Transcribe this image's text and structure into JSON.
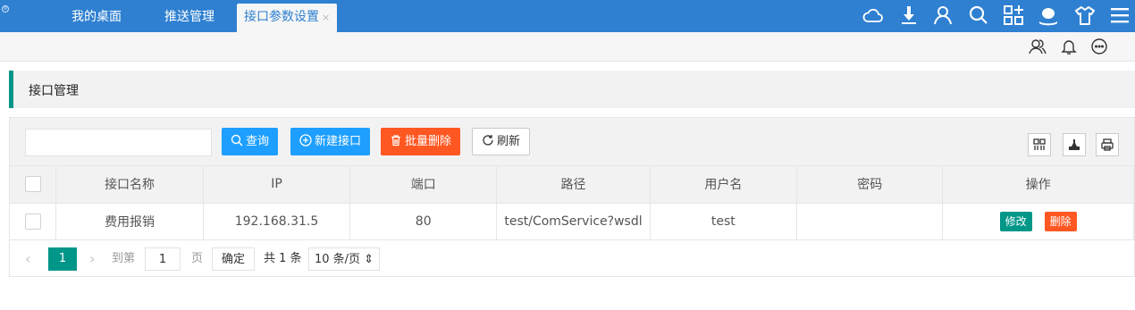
{
  "topbar": {
    "tabs": [
      "我的桌面",
      "推送管理",
      "接口参数设置"
    ],
    "tab_close": "×",
    "icons": [
      "cloud-icon",
      "download-icon",
      "user-icon",
      "search-icon",
      "apps-icon",
      "skin-icon",
      "shirt-icon",
      "menu-icon"
    ],
    "color": "#2f80d1"
  },
  "subbar": {
    "icons": [
      "users-icon",
      "bell-icon",
      "chat-icon"
    ]
  },
  "page": {
    "title": "接口管理"
  },
  "toolbar": {
    "search_placeholder": "",
    "query_label": "查询",
    "add_label": "新建接口",
    "batch_delete_label": "批量删除",
    "refresh_label": "刷新",
    "right_tools": [
      "columns-icon",
      "export-icon",
      "print-icon"
    ]
  },
  "table": {
    "columns": [
      "接口名称",
      "IP",
      "端口",
      "路径",
      "用户名",
      "密码",
      "操作"
    ],
    "rows": [
      {
        "name": "费用报销",
        "ip": "192.168.31.5",
        "port": "80",
        "path": "test/ComService?wsdl",
        "username": "test",
        "password": "",
        "edit": "修改",
        "delete": "删除"
      }
    ]
  },
  "pager": {
    "current": "1",
    "goto_prefix": "到第",
    "goto_value": "1",
    "goto_suffix": "页",
    "confirm": "确定",
    "total": "共 1 条",
    "page_size": "10 条/页"
  },
  "colors": {
    "accent": "#009688",
    "blue": "#1e9fff",
    "orange": "#ff5722"
  }
}
